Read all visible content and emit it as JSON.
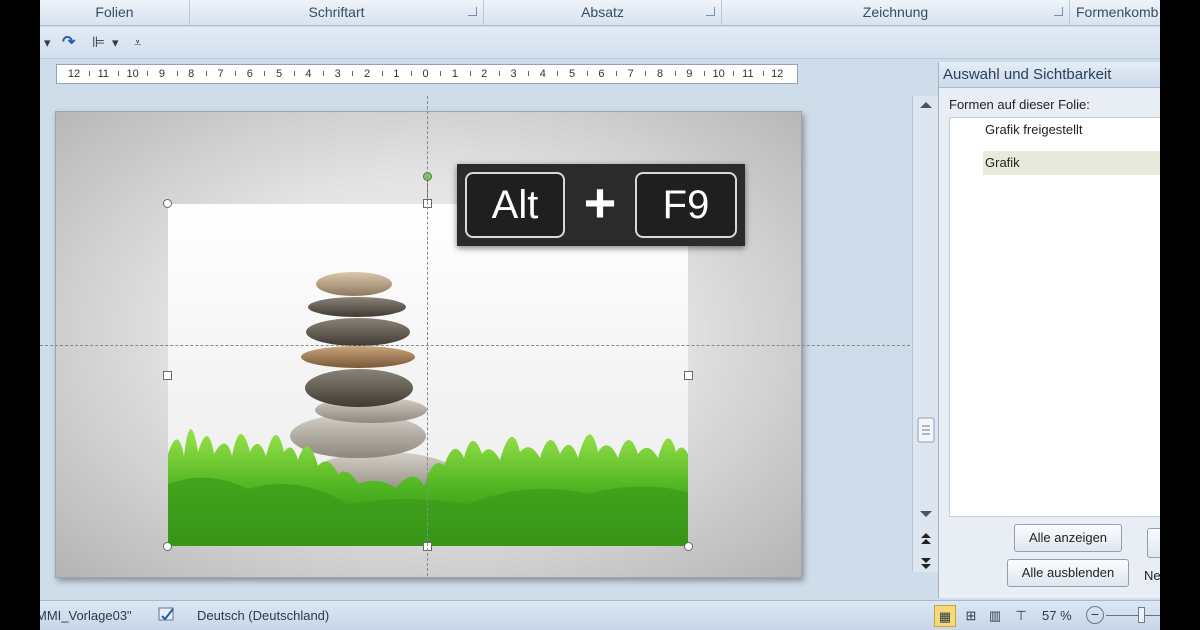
{
  "ribbon": {
    "groups": [
      "Folien",
      "Schriftart",
      "Absatz",
      "Zeichnung",
      "Formenkomb"
    ]
  },
  "quick_access": {
    "dropdown_arrow": "▾",
    "redo_icon": "↷",
    "align_icon": "⊫",
    "customize_icon": "⩡"
  },
  "ruler": {
    "ticks": [
      "12",
      "11",
      "10",
      "9",
      "8",
      "7",
      "6",
      "5",
      "4",
      "3",
      "2",
      "1",
      "0",
      "1",
      "2",
      "3",
      "4",
      "5",
      "6",
      "7",
      "8",
      "9",
      "10",
      "11",
      "12"
    ]
  },
  "overlay": {
    "key1": "Alt",
    "plus": "+",
    "key2": "F9"
  },
  "pane": {
    "title": "Auswahl und Sichtbarkeit",
    "label": "Formen auf dieser Folie:",
    "shapes": [
      {
        "name": "Grafik freigestellt",
        "selected": false
      },
      {
        "name": "Grafik",
        "selected": true
      }
    ],
    "show_all": "Alle anzeigen",
    "hide_all": "Alle ausblenden",
    "partial_label": "Ne"
  },
  "status": {
    "doc": "MMI_Vorlage03\"",
    "language": "Deutsch (Deutschland)",
    "zoom": "57 %"
  },
  "colors": {
    "accent": "#cfdcea",
    "selected_row": "#e9eadc",
    "overlay_bg": "#2b2b2b",
    "rotate_handle": "#7bd14a"
  }
}
